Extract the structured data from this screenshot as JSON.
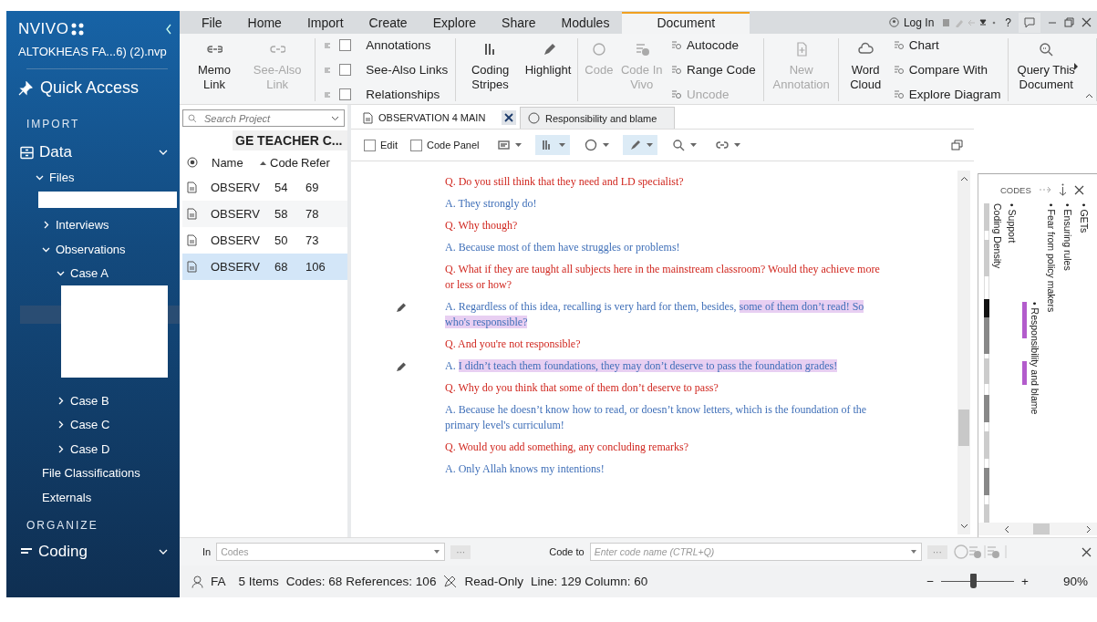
{
  "app": {
    "logo": "NVIVO",
    "project": "ALTOKHEAS FA...6) (2).nvp"
  },
  "sidebar": {
    "quick_access": "Quick Access",
    "import_heading": "IMPORT",
    "data_label": "Data",
    "tree": [
      {
        "kind": "node",
        "label": "Files",
        "expanded": true,
        "children": [
          {
            "kind": "redacted-line"
          },
          {
            "kind": "node",
            "label": "Interviews",
            "expanded": false
          },
          {
            "kind": "node",
            "label": "Observations",
            "expanded": true,
            "children": [
              {
                "kind": "node",
                "label": "Case A",
                "expanded": true,
                "children": [
                  {
                    "kind": "redacted-block"
                  }
                ]
              },
              {
                "kind": "node",
                "label": "Case B",
                "expanded": false
              },
              {
                "kind": "node",
                "label": "Case C",
                "expanded": false
              },
              {
                "kind": "node",
                "label": "Case D",
                "expanded": false
              }
            ]
          }
        ]
      },
      {
        "kind": "leaf",
        "label": "File Classifications"
      },
      {
        "kind": "leaf",
        "label": "Externals"
      }
    ],
    "organize_heading": "ORGANIZE",
    "coding_label": "Coding"
  },
  "menu_tabs": [
    {
      "label": "File",
      "selected": false
    },
    {
      "label": "Home",
      "selected": false
    },
    {
      "label": "Import",
      "selected": false
    },
    {
      "label": "Create",
      "selected": false
    },
    {
      "label": "Explore",
      "selected": false
    },
    {
      "label": "Share",
      "selected": false
    },
    {
      "label": "Modules",
      "selected": false
    },
    {
      "label": "Document",
      "selected": true
    }
  ],
  "title_bar": {
    "login": "Log In",
    "help": "?"
  },
  "ribbon": {
    "groups": [
      {
        "items": [
          {
            "kind": "large",
            "label": "Memo Link",
            "disabled": false
          },
          {
            "kind": "large",
            "label": "See-Also Link",
            "disabled": true
          }
        ]
      },
      {
        "items": [
          {
            "kind": "check",
            "label": "Annotations",
            "checked": false
          },
          {
            "kind": "check",
            "label": "See-Also Links",
            "checked": false
          },
          {
            "kind": "check",
            "label": "Relationships",
            "checked": false
          }
        ]
      },
      {
        "items": [
          {
            "kind": "large",
            "label": "Coding Stripes",
            "disabled": false
          },
          {
            "kind": "large",
            "label": "Highlight",
            "disabled": false
          }
        ]
      },
      {
        "items": [
          {
            "kind": "large",
            "label": "Code",
            "disabled": true
          },
          {
            "kind": "large",
            "label": "Code In Vivo",
            "disabled": true
          },
          {
            "kind": "small",
            "label": "Autocode",
            "disabled": false
          },
          {
            "kind": "small",
            "label": "Range Code",
            "disabled": false
          },
          {
            "kind": "small",
            "label": "Uncode",
            "disabled": true
          }
        ]
      },
      {
        "items": [
          {
            "kind": "large",
            "label": "New Annotation",
            "disabled": true
          }
        ]
      },
      {
        "items": [
          {
            "kind": "large",
            "label": "Word Cloud",
            "disabled": false
          },
          {
            "kind": "small",
            "label": "Chart",
            "disabled": false
          },
          {
            "kind": "small",
            "label": "Compare With",
            "disabled": false
          },
          {
            "kind": "small",
            "label": "Explore Diagram",
            "disabled": false
          }
        ]
      },
      {
        "items": [
          {
            "kind": "large",
            "label": "Query This Document",
            "disabled": false
          }
        ]
      }
    ]
  },
  "list_panel": {
    "search_placeholder": "Search Project",
    "heading": "GE TEACHER C...",
    "columns": [
      "Name",
      "Code",
      "Refer"
    ],
    "rows": [
      {
        "name": "OBSERV",
        "code": "54",
        "refer": "69",
        "selected": false
      },
      {
        "name": "OBSERV",
        "code": "58",
        "refer": "78",
        "selected": false
      },
      {
        "name": "OBSERV",
        "code": "50",
        "refer": "73",
        "selected": false
      },
      {
        "name": "OBSERV",
        "code": "68",
        "refer": "106",
        "selected": true
      }
    ]
  },
  "document": {
    "tabs": [
      {
        "label": "OBSERVATION 4 MAIN",
        "selected": true
      },
      {
        "label": "Responsibility and blame",
        "selected": false
      }
    ],
    "toolbar": {
      "checks": [
        {
          "label": "Edit",
          "checked": false
        },
        {
          "label": "Code Panel",
          "checked": false
        }
      ],
      "tools": [
        {
          "pressed": false
        },
        {
          "pressed": true
        },
        {
          "pressed": false
        },
        {
          "pressed": true
        },
        {
          "pressed": false
        },
        {
          "pressed": false
        }
      ]
    },
    "paragraphs": [
      {
        "kind": "question",
        "marked": false,
        "segments": [
          {
            "text": "Q. Do you still think that they need and LD specialist?",
            "highlighted": false
          }
        ]
      },
      {
        "kind": "answer",
        "marked": false,
        "segments": [
          {
            "text": "A. They strongly do!",
            "highlighted": false
          }
        ]
      },
      {
        "kind": "question",
        "marked": false,
        "segments": [
          {
            "text": "Q. Why though?",
            "highlighted": false
          }
        ]
      },
      {
        "kind": "answer",
        "marked": false,
        "segments": [
          {
            "text": "A. Because most of them have struggles or problems!",
            "highlighted": false
          }
        ]
      },
      {
        "kind": "question",
        "marked": false,
        "segments": [
          {
            "text": "Q. What if they are taught all subjects here in the mainstream classroom? Would they achieve more or less or how?",
            "highlighted": false
          }
        ]
      },
      {
        "kind": "answer",
        "marked": true,
        "segments": [
          {
            "text": "A. Regardless of this idea, recalling is very hard for them, besides, ",
            "highlighted": false
          },
          {
            "text": "some of them don’t read! So who's responsible?",
            "highlighted": true
          }
        ]
      },
      {
        "kind": "question",
        "marked": false,
        "segments": [
          {
            "text": "Q. And you're not responsible?",
            "highlighted": false
          }
        ]
      },
      {
        "kind": "answer",
        "marked": true,
        "segments": [
          {
            "text": "A. ",
            "highlighted": false
          },
          {
            "text": "I didn’t teach them foundations, they may don’t deserve to pass the foundation grades!",
            "highlighted": true
          }
        ]
      },
      {
        "kind": "question",
        "marked": false,
        "segments": [
          {
            "text": "Q. Why do you think that some of them don’t deserve to pass?",
            "highlighted": false
          }
        ]
      },
      {
        "kind": "answer",
        "marked": false,
        "segments": [
          {
            "text": "A. Because he doesn’t know how to read, or doesn’t know letters, which is the foundation of the primary level's curriculum!",
            "highlighted": false
          }
        ]
      },
      {
        "kind": "question",
        "marked": false,
        "segments": [
          {
            "text": "Q. Would you add something, any concluding remarks?",
            "highlighted": false
          }
        ]
      },
      {
        "kind": "answer",
        "marked": false,
        "segments": [
          {
            "text": "A. Only Allah knows my intentions!",
            "highlighted": false
          }
        ]
      }
    ]
  },
  "codes_panel": {
    "title": "CODES",
    "codes": [
      {
        "kind": "code",
        "label": "• GETs"
      },
      {
        "kind": "code",
        "label": "• Ensuring rules"
      },
      {
        "kind": "code",
        "label": "• Fear from policy makers"
      },
      {
        "kind": "coded",
        "label": "• Responsibility and blame",
        "color": "#b35ccc"
      },
      {
        "kind": "code",
        "label": "• Support"
      }
    ],
    "density_label": "Coding Density"
  },
  "code_bar": {
    "in_label": "In",
    "in_placeholder": "Codes",
    "more": "···",
    "code_to_label": "Code to",
    "code_to_placeholder": "Enter code name (CTRL+Q)",
    "more2": "···"
  },
  "status_bar": {
    "user": "FA",
    "items": "5 Items",
    "codes": "Codes: 68",
    "references": "References: 106",
    "mode": "Read-Only",
    "position": "Line: 129 Column: 60",
    "zoom_minus": "−",
    "zoom_plus": "+",
    "level": 0.45,
    "zoom": "90%"
  }
}
